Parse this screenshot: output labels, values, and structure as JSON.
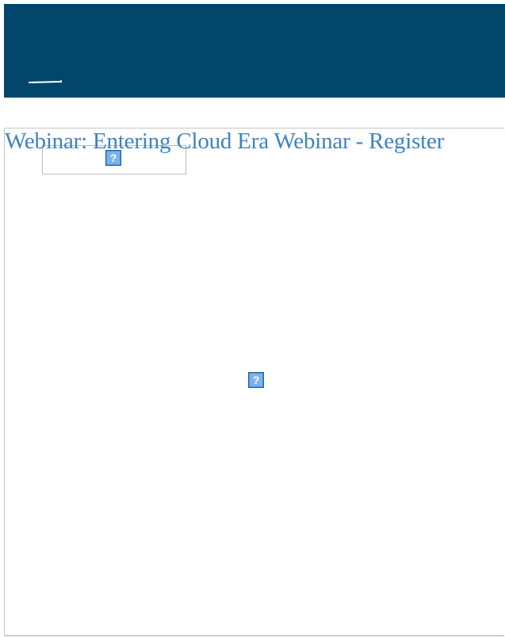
{
  "header": {
    "background_color": "#02476b",
    "mark_icon": "dash-logo-icon"
  },
  "main": {
    "webinar_link_text": "Webinar: Entering Cloud Era Webinar - Register",
    "link_color": "#3d82c3",
    "top_image_icon": "broken-image-icon",
    "center_image_icon": "broken-image-icon"
  }
}
